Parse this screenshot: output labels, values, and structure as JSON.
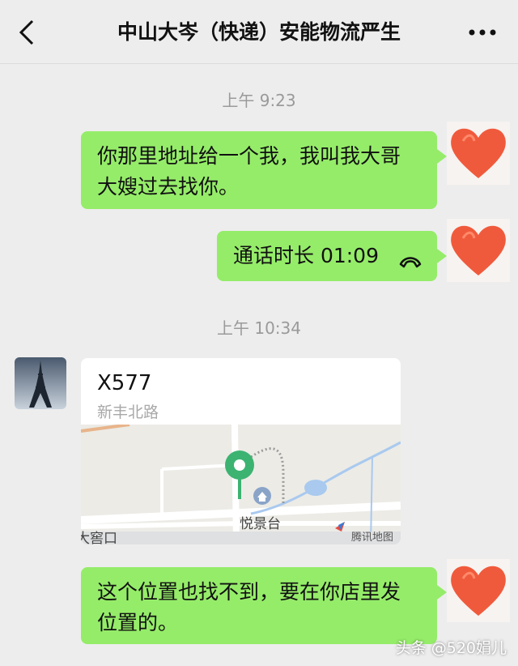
{
  "header": {
    "title": "中山大岑（快递）安能物流严生"
  },
  "messages": {
    "time1": "上午 9:23",
    "msg1_line1": "你那里地址给一个我，我叫我大哥",
    "msg1_line2": "大嫂过去找你。",
    "call_label": "通话时长 01:09",
    "time2": "上午 10:34",
    "location": {
      "name": "X577",
      "address": "新丰北路",
      "poi_label": "悦景台",
      "road_label": "大窖口",
      "provider": "腾讯地图"
    },
    "msg2_line1": "这个位置也找不到，要在你店里发",
    "msg2_line2": "位置的。"
  },
  "watermark": "头条 @520娟儿",
  "icons": {
    "back": "back-chevron-icon",
    "more": "more-dots-icon",
    "call": "phone-hangup-icon",
    "avatar_me": "heart-avatar",
    "avatar_other": "eiffel-tower-avatar",
    "pin": "map-pin-icon"
  },
  "colors": {
    "bubble_out": "#95ec69",
    "pin": "#3cb371",
    "heart": "#f05a3c"
  }
}
